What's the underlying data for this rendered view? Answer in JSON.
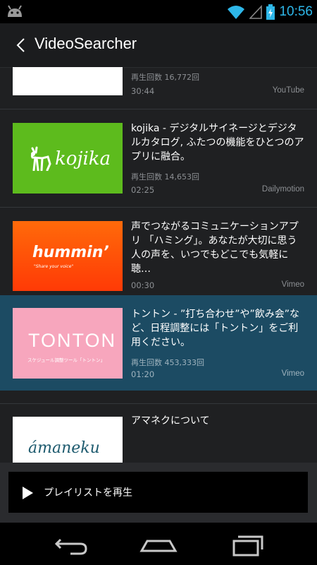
{
  "status_bar": {
    "time": "10:56"
  },
  "app": {
    "title": "VideoSearcher"
  },
  "videos": [
    {
      "title": "",
      "views": "再生回数 16,772回",
      "duration": "30:44",
      "source": "YouTube"
    },
    {
      "title": "kojika - デジタルサイネージとデジタルカタログ, ふたつの機能をひとつのアプリに融合。",
      "thumb_text": "kojika",
      "thumb_color": "#5dbb1d",
      "views": "再生回数 14,653回",
      "duration": "02:25",
      "source": "Dailymotion"
    },
    {
      "title": "声でつながるコミュニケーションアプリ 「ハミング」。あなたが大切に思う人の声を、いつでもどこでも気軽に聴…",
      "thumb_text": "hummin’",
      "thumb_sub": "\"Share your voice\"",
      "thumb_color": "#ff4a08",
      "views": "",
      "duration": "00:30",
      "source": "Vimeo"
    },
    {
      "title": "トントン - ”打ち合わせ”や”飲み会”など、日程調整には「トントン」をご利用ください。",
      "thumb_text": "TONTON",
      "thumb_sub": "スケジュール調整ツール「トントン」",
      "thumb_color": "#f7a6bd",
      "views": "再生回数 453,333回",
      "duration": "01:20",
      "source": "Vimeo",
      "selected": true
    },
    {
      "title": "アマネクについて",
      "thumb_text": "ámaneku",
      "thumb_color": "#ffffff"
    }
  ],
  "play_button": {
    "label": "プレイリストを再生"
  },
  "colors": {
    "accent": "#2eb7e9",
    "selected_row": "#1c4b63"
  }
}
